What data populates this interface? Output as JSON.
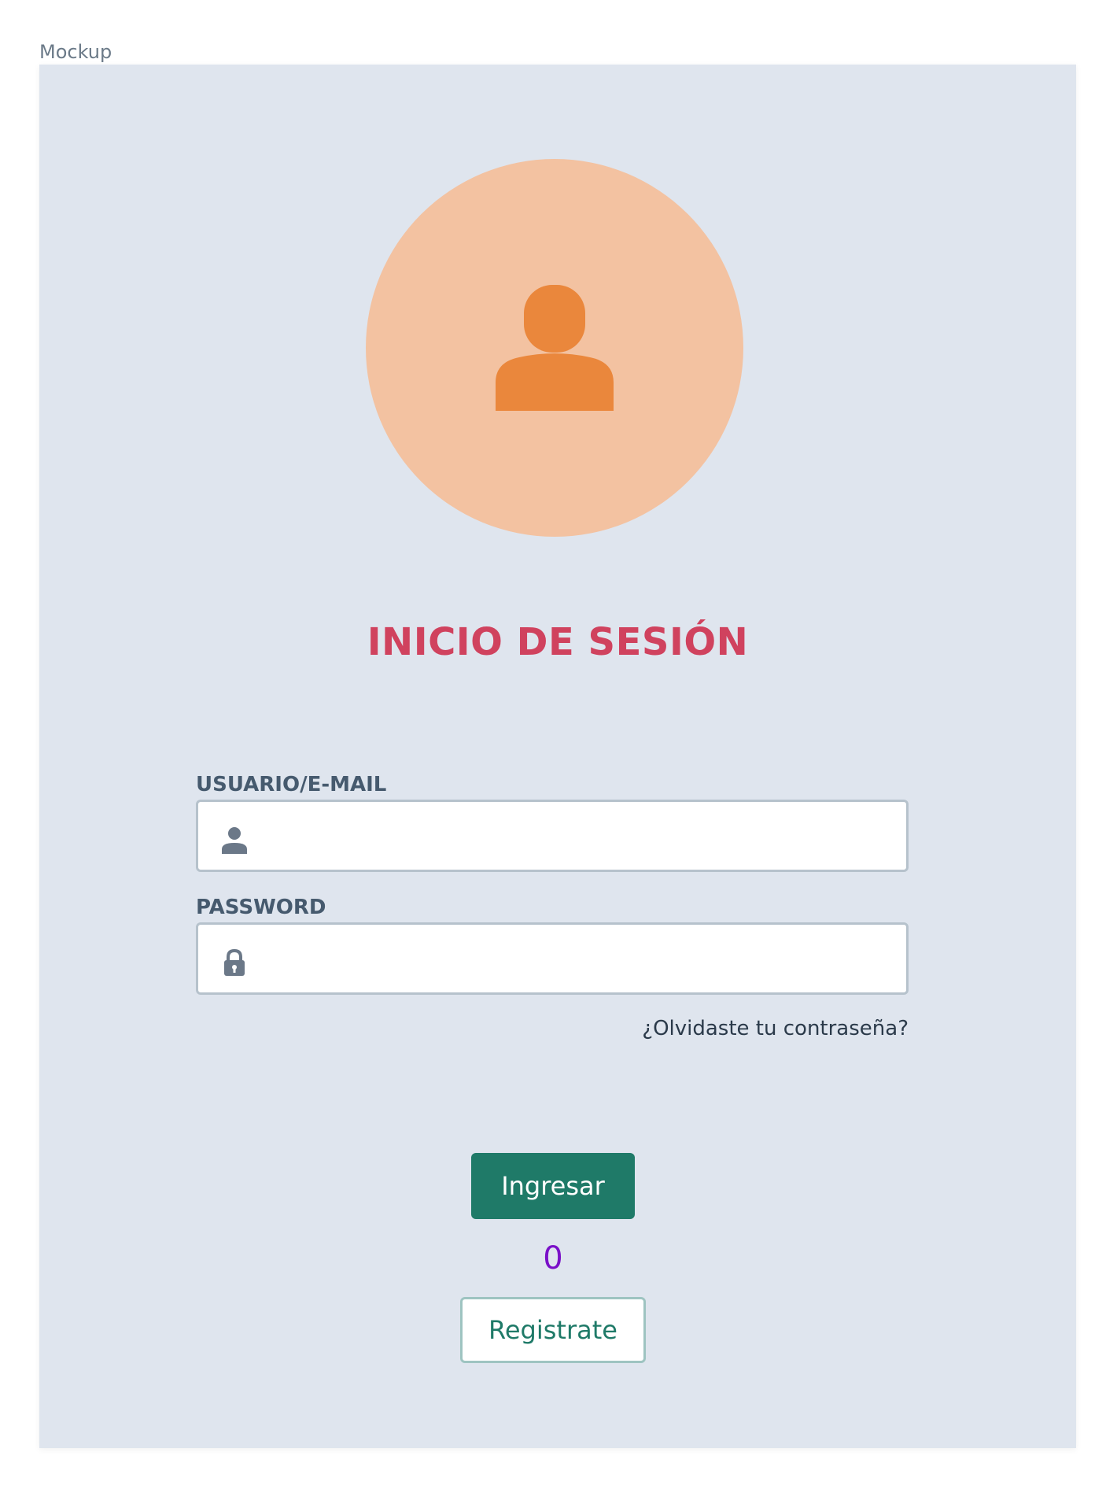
{
  "caption": "Mockup",
  "avatar": {
    "icon": "user-icon"
  },
  "title": "INICIO DE SESIÓN",
  "username": {
    "label": "USUARIO/E-MAIL",
    "icon": "user-icon",
    "value": "",
    "placeholder": ""
  },
  "password": {
    "label": "PASSWORD",
    "icon": "lock-icon",
    "value": "",
    "placeholder": ""
  },
  "forgot_password": "¿Olvidaste tu contraseña?",
  "login_button": "Ingresar",
  "counter": "0",
  "register_button": "Registrate",
  "colors": {
    "background": "#dfe5ee",
    "avatar_bg": "#f3c2a1",
    "avatar_icon": "#ea873c",
    "title": "#d0425e",
    "primary": "#1f7a68",
    "counter": "#7a10c8"
  }
}
